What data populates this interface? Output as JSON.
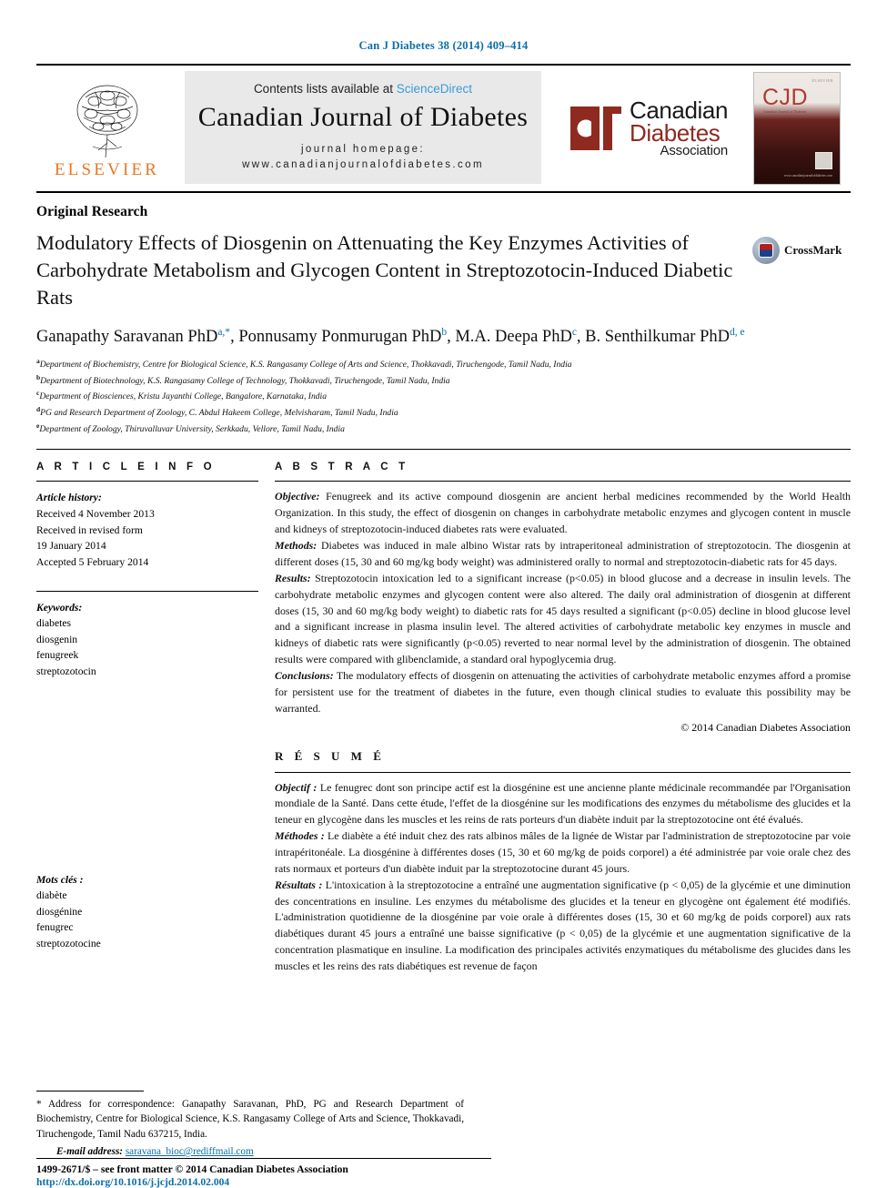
{
  "running_head": "Can J Diabetes 38 (2014) 409–414",
  "masthead": {
    "elsevier_wordmark": "ELSEVIER",
    "contents_prefix": "Contents lists available at ",
    "contents_link": "ScienceDirect",
    "journal_title": "Canadian Journal of Diabetes",
    "homepage_label": "journal homepage:",
    "homepage_url": "www.canadianjournalofdiabetes.com",
    "cda_line1": "Canadian",
    "cda_line2": "Diabetes",
    "cda_line3": "Association",
    "cover_title": "CJD",
    "cover_subtitle": "Canadian Journal of Diabetes",
    "cover_brand": "ELSEVIER",
    "cover_url": "www.canadianjournalofdiabetes.com",
    "accent_red": "#8e2a20",
    "accent_blue": "#0b6ea8",
    "accent_orange": "#e87722"
  },
  "article": {
    "type": "Original Research",
    "title": "Modulatory Effects of Diosgenin on Attenuating the Key Enzymes Activities of Carbohydrate Metabolism and Glycogen Content in Streptozotocin-Induced Diabetic Rats",
    "crossmark_label": "CrossMark",
    "authors": [
      {
        "name": "Ganapathy Saravanan PhD",
        "marks": "a,*"
      },
      {
        "name": "Ponnusamy Ponmurugan PhD",
        "marks": "b"
      },
      {
        "name": "M.A. Deepa PhD",
        "marks": "c"
      },
      {
        "name": "B. Senthilkumar PhD",
        "marks": "d, e"
      }
    ],
    "affiliations": [
      {
        "mark": "a",
        "text": "Department of Biochemistry, Centre for Biological Science, K.S. Rangasamy College of Arts and Science, Thokkavadi, Tiruchengode, Tamil Nadu, India"
      },
      {
        "mark": "b",
        "text": "Department of Biotechnology, K.S. Rangasamy College of Technology, Thokkavadi, Tiruchengode, Tamil Nadu, India"
      },
      {
        "mark": "c",
        "text": "Department of Biosciences, Kristu Jayanthi College, Bangalore, Karnataka, India"
      },
      {
        "mark": "d",
        "text": "PG and Research Department of Zoology, C. Abdul Hakeem College, Melvisharam, Tamil Nadu, India"
      },
      {
        "mark": "e",
        "text": "Department of Zoology, Thiruvalluvar University, Serkkadu, Vellore, Tamil Nadu, India"
      }
    ]
  },
  "article_info": {
    "heading": "A R T I C L E   I N F O",
    "history_label": "Article history:",
    "received": "Received 4 November 2013",
    "revised_label": "Received in revised form",
    "revised_date": "19 January 2014",
    "accepted": "Accepted 5 February 2014",
    "keywords_label": "Keywords:",
    "keywords": [
      "diabetes",
      "diosgenin",
      "fenugreek",
      "streptozotocin"
    ],
    "motscles_label": "Mots clés :",
    "motscles": [
      "diabète",
      "diosgénine",
      "fenugrec",
      "streptozotocine"
    ]
  },
  "abstract": {
    "heading": "A B S T R A C T",
    "sections": [
      {
        "label": "Objective:",
        "text": " Fenugreek and its active compound diosgenin are ancient herbal medicines recommended by the World Health Organization. In this study, the effect of diosgenin on changes in carbohydrate metabolic enzymes and glycogen content in muscle and kidneys of streptozotocin-induced diabetes rats were evaluated."
      },
      {
        "label": "Methods:",
        "text": " Diabetes was induced in male albino Wistar rats by intraperitoneal administration of streptozotocin. The diosgenin at different doses (15, 30 and 60 mg/kg body weight) was administered orally to normal and streptozotocin-diabetic rats for 45 days."
      },
      {
        "label": "Results:",
        "text": " Streptozotocin intoxication led to a significant increase (p<0.05) in blood glucose and a decrease in insulin levels. The carbohydrate metabolic enzymes and glycogen content were also altered. The daily oral administration of diosgenin at different doses (15, 30 and 60 mg/kg body weight) to diabetic rats for 45 days resulted a significant (p<0.05) decline in blood glucose level and a significant increase in plasma insulin level. The altered activities of carbohydrate metabolic key enzymes in muscle and kidneys of diabetic rats were significantly (p<0.05) reverted to near normal level by the administration of diosgenin. The obtained results were compared with glibenclamide, a standard oral hypoglycemia drug."
      },
      {
        "label": "Conclusions:",
        "text": " The modulatory effects of diosgenin on attenuating the activities of carbohydrate metabolic enzymes afford a promise for persistent use for the treatment of diabetes in the future, even though clinical studies to evaluate this possibility may be warranted."
      }
    ],
    "copyright": "© 2014 Canadian Diabetes Association"
  },
  "resume": {
    "heading": "R É S U M É",
    "sections": [
      {
        "label": "Objectif :",
        "text": " Le fenugrec dont son principe actif est la diosgénine est une ancienne plante médicinale recommandée par l'Organisation mondiale de la Santé. Dans cette étude, l'effet de la diosgénine sur les modifications des enzymes du métabolisme des glucides et la teneur en glycogène dans les muscles et les reins de rats porteurs d'un diabète induit par la streptozotocine ont été évalués."
      },
      {
        "label": "Méthodes :",
        "text": " Le diabète a été induit chez des rats albinos mâles de la lignée de Wistar par l'administration de streptozotocine par voie intrapéritonéale. La diosgénine à différentes doses (15, 30 et 60 mg/kg de poids corporel) a été administrée par voie orale chez des rats normaux et porteurs d'un diabète induit par la streptozotocine durant 45 jours."
      },
      {
        "label": "Résultats :",
        "text": " L'intoxication à la streptozotocine a entraîné une augmentation significative (p < 0,05) de la glycémie et une diminution des concentrations en insuline. Les enzymes du métabolisme des glucides et la teneur en glycogène ont également été modifiés. L'administration quotidienne de la diosgénine par voie orale à différentes doses (15, 30 et 60 mg/kg de poids corporel) aux rats diabétiques durant 45 jours a entraîné une baisse significative (p < 0,05) de la glycémie et une augmentation significative de la concentration plasmatique en insuline. La modification des principales activités enzymatiques du métabolisme des glucides dans les muscles et les reins des rats diabétiques est revenue de façon"
      }
    ]
  },
  "footnote": {
    "correspondence": "* Address for correspondence: Ganapathy Saravanan, PhD, PG and Research Department of Biochemistry, Centre for Biological Science, K.S. Rangasamy College of Arts and Science, Thokkavadi, Tiruchengode, Tamil Nadu 637215, India.",
    "email_label": "E-mail address:",
    "email": "saravana_bioc@rediffmail.com"
  },
  "footer": {
    "issn_line": "1499-2671/$ – see front matter © 2014 Canadian Diabetes Association",
    "doi": "http://dx.doi.org/10.1016/j.jcjd.2014.02.004"
  }
}
